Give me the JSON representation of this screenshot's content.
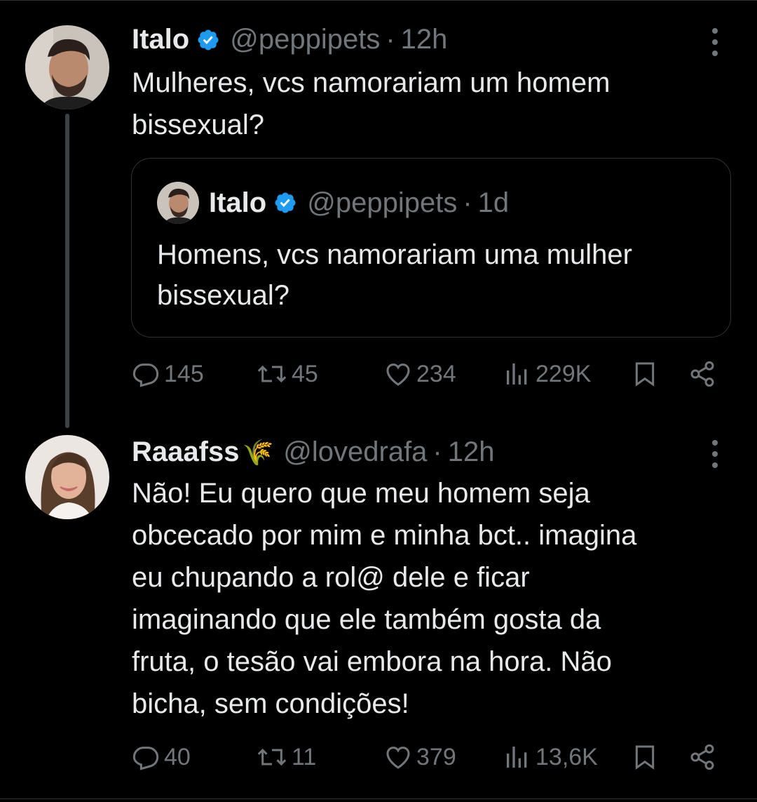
{
  "tweets": [
    {
      "name": "Italo",
      "handle": "@peppipets",
      "time": "12h",
      "text_lines": [
        "Mulheres, vcs namorariam um homem",
        "bissexual?"
      ],
      "quote": {
        "name": "Italo",
        "handle": "@peppipets",
        "time": "1d",
        "text_lines": [
          "Homens, vcs namorariam uma mulher",
          "bissexual?"
        ]
      },
      "replies": "145",
      "reposts": "45",
      "likes": "234",
      "views": "229K"
    },
    {
      "name": "Raaafss",
      "name_emoji": "🌾",
      "handle": "@lovedrafa",
      "time": "12h",
      "text_lines": [
        "Não! Eu quero que meu homem seja",
        "obcecado por mim e minha bct.. imagina",
        "eu chupando a rol@ dele e ficar",
        "imaginando que ele também gosta da",
        "fruta, o tesão vai embora na hora. Não",
        "bicha, sem condições!"
      ],
      "replies": "40",
      "reposts": "11",
      "likes": "379",
      "views": "13,6K"
    }
  ],
  "colors": {
    "background": "#000000",
    "text": "#e7e9ea",
    "muted": "#71767b",
    "verified": "#1d9bf0",
    "border": "#2f3336"
  },
  "icons": [
    "reply-icon",
    "repost-icon",
    "like-icon",
    "views-icon",
    "bookmark-icon",
    "share-icon",
    "verified-icon",
    "more-icon"
  ]
}
